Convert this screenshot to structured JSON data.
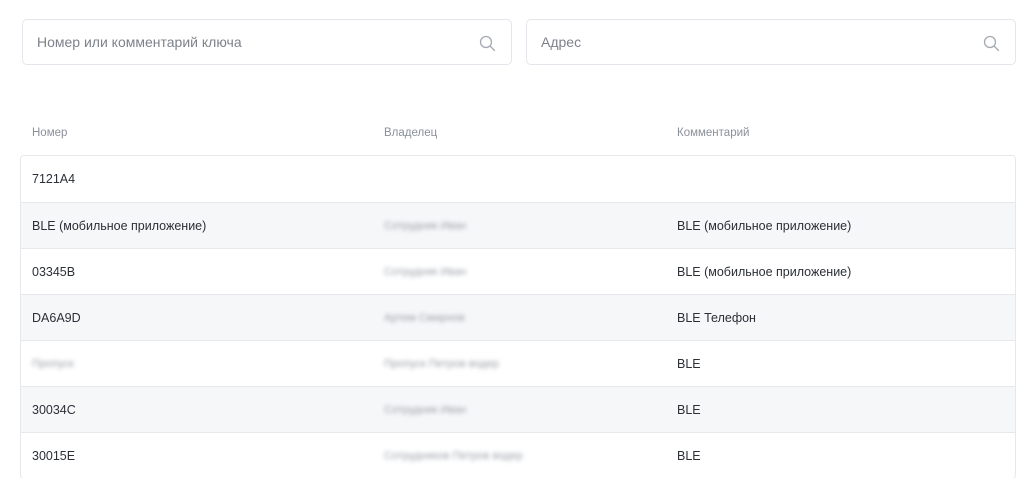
{
  "search": {
    "key_placeholder": "Номер или комментарий ключа",
    "key_value": "",
    "address_placeholder": "Адрес",
    "address_value": ""
  },
  "table": {
    "columns": [
      "Номер",
      "Владелец",
      "Комментарий"
    ],
    "rows": [
      {
        "number": "7121A4",
        "owner": "",
        "comment": ""
      },
      {
        "number": "BLE (мобильное приложение)",
        "owner": "Сотрудник Иван",
        "comment": "BLE (мобильное приложение)"
      },
      {
        "number": "03345B",
        "owner": "Сотрудник Иван",
        "comment": "BLE (мобильное приложение)"
      },
      {
        "number": "DA6A9D",
        "owner": "Артем Смирнов",
        "comment": "BLE Телефон"
      },
      {
        "number": "Пропуск",
        "owner": "Пропуск Петров водер",
        "comment": "BLE"
      },
      {
        "number": "30034C",
        "owner": "Сотрудник Иван",
        "comment": "BLE"
      },
      {
        "number": "30015E",
        "owner": "Сотрудников Петров водер",
        "comment": "BLE"
      }
    ],
    "blurred": [
      {
        "number": false,
        "owner": false
      },
      {
        "number": false,
        "owner": true
      },
      {
        "number": false,
        "owner": true
      },
      {
        "number": false,
        "owner": true
      },
      {
        "number": true,
        "owner": true
      },
      {
        "number": false,
        "owner": true
      },
      {
        "number": false,
        "owner": true
      }
    ]
  },
  "colors": {
    "border": "#e6e8eb",
    "row_alt": "#f6f7f9",
    "header_text": "#8a9099",
    "icon": "#a4aab2"
  },
  "icons": {
    "search": "search-icon"
  }
}
